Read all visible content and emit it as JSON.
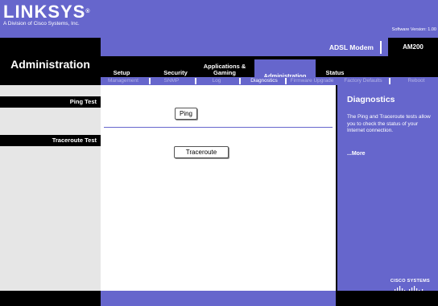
{
  "header": {
    "brand": "LINKSYS",
    "trademark": "®",
    "tagline": "A Division of Cisco Systems, Inc.",
    "software_version": "Software Version: 1.00"
  },
  "product": {
    "name": "ADSL Modem",
    "model": "AM200"
  },
  "page_title": "Administration",
  "tabs": [
    {
      "label": "Setup",
      "active": false
    },
    {
      "label": "Security",
      "active": false
    },
    {
      "label": "Applications &\nGaming",
      "active": false
    },
    {
      "label": "Administration",
      "active": true
    },
    {
      "label": "Status",
      "active": false
    }
  ],
  "subtabs": [
    {
      "label": "Management",
      "active": false
    },
    {
      "label": "SNMP",
      "active": false
    },
    {
      "label": "Log",
      "active": false
    },
    {
      "label": "Diagnostics",
      "active": true
    },
    {
      "label": "Firmware Upgrade",
      "active": false
    },
    {
      "label": "Factory Defaults",
      "active": false
    },
    {
      "label": "Reboot",
      "active": false
    }
  ],
  "sections": {
    "ping": {
      "heading": "Ping Test",
      "button": "Ping"
    },
    "traceroute": {
      "heading": "Traceroute Test",
      "button": "Traceroute"
    }
  },
  "help": {
    "title": "Diagnostics",
    "text": "The Ping and Traceroute tests allow you to check the status of your Internet connection.",
    "more": "...More"
  },
  "cisco": {
    "name": "CISCO SYSTEMS"
  },
  "colors": {
    "accent": "#6666cc",
    "dark": "#000000",
    "panel": "#e6e6e6"
  }
}
